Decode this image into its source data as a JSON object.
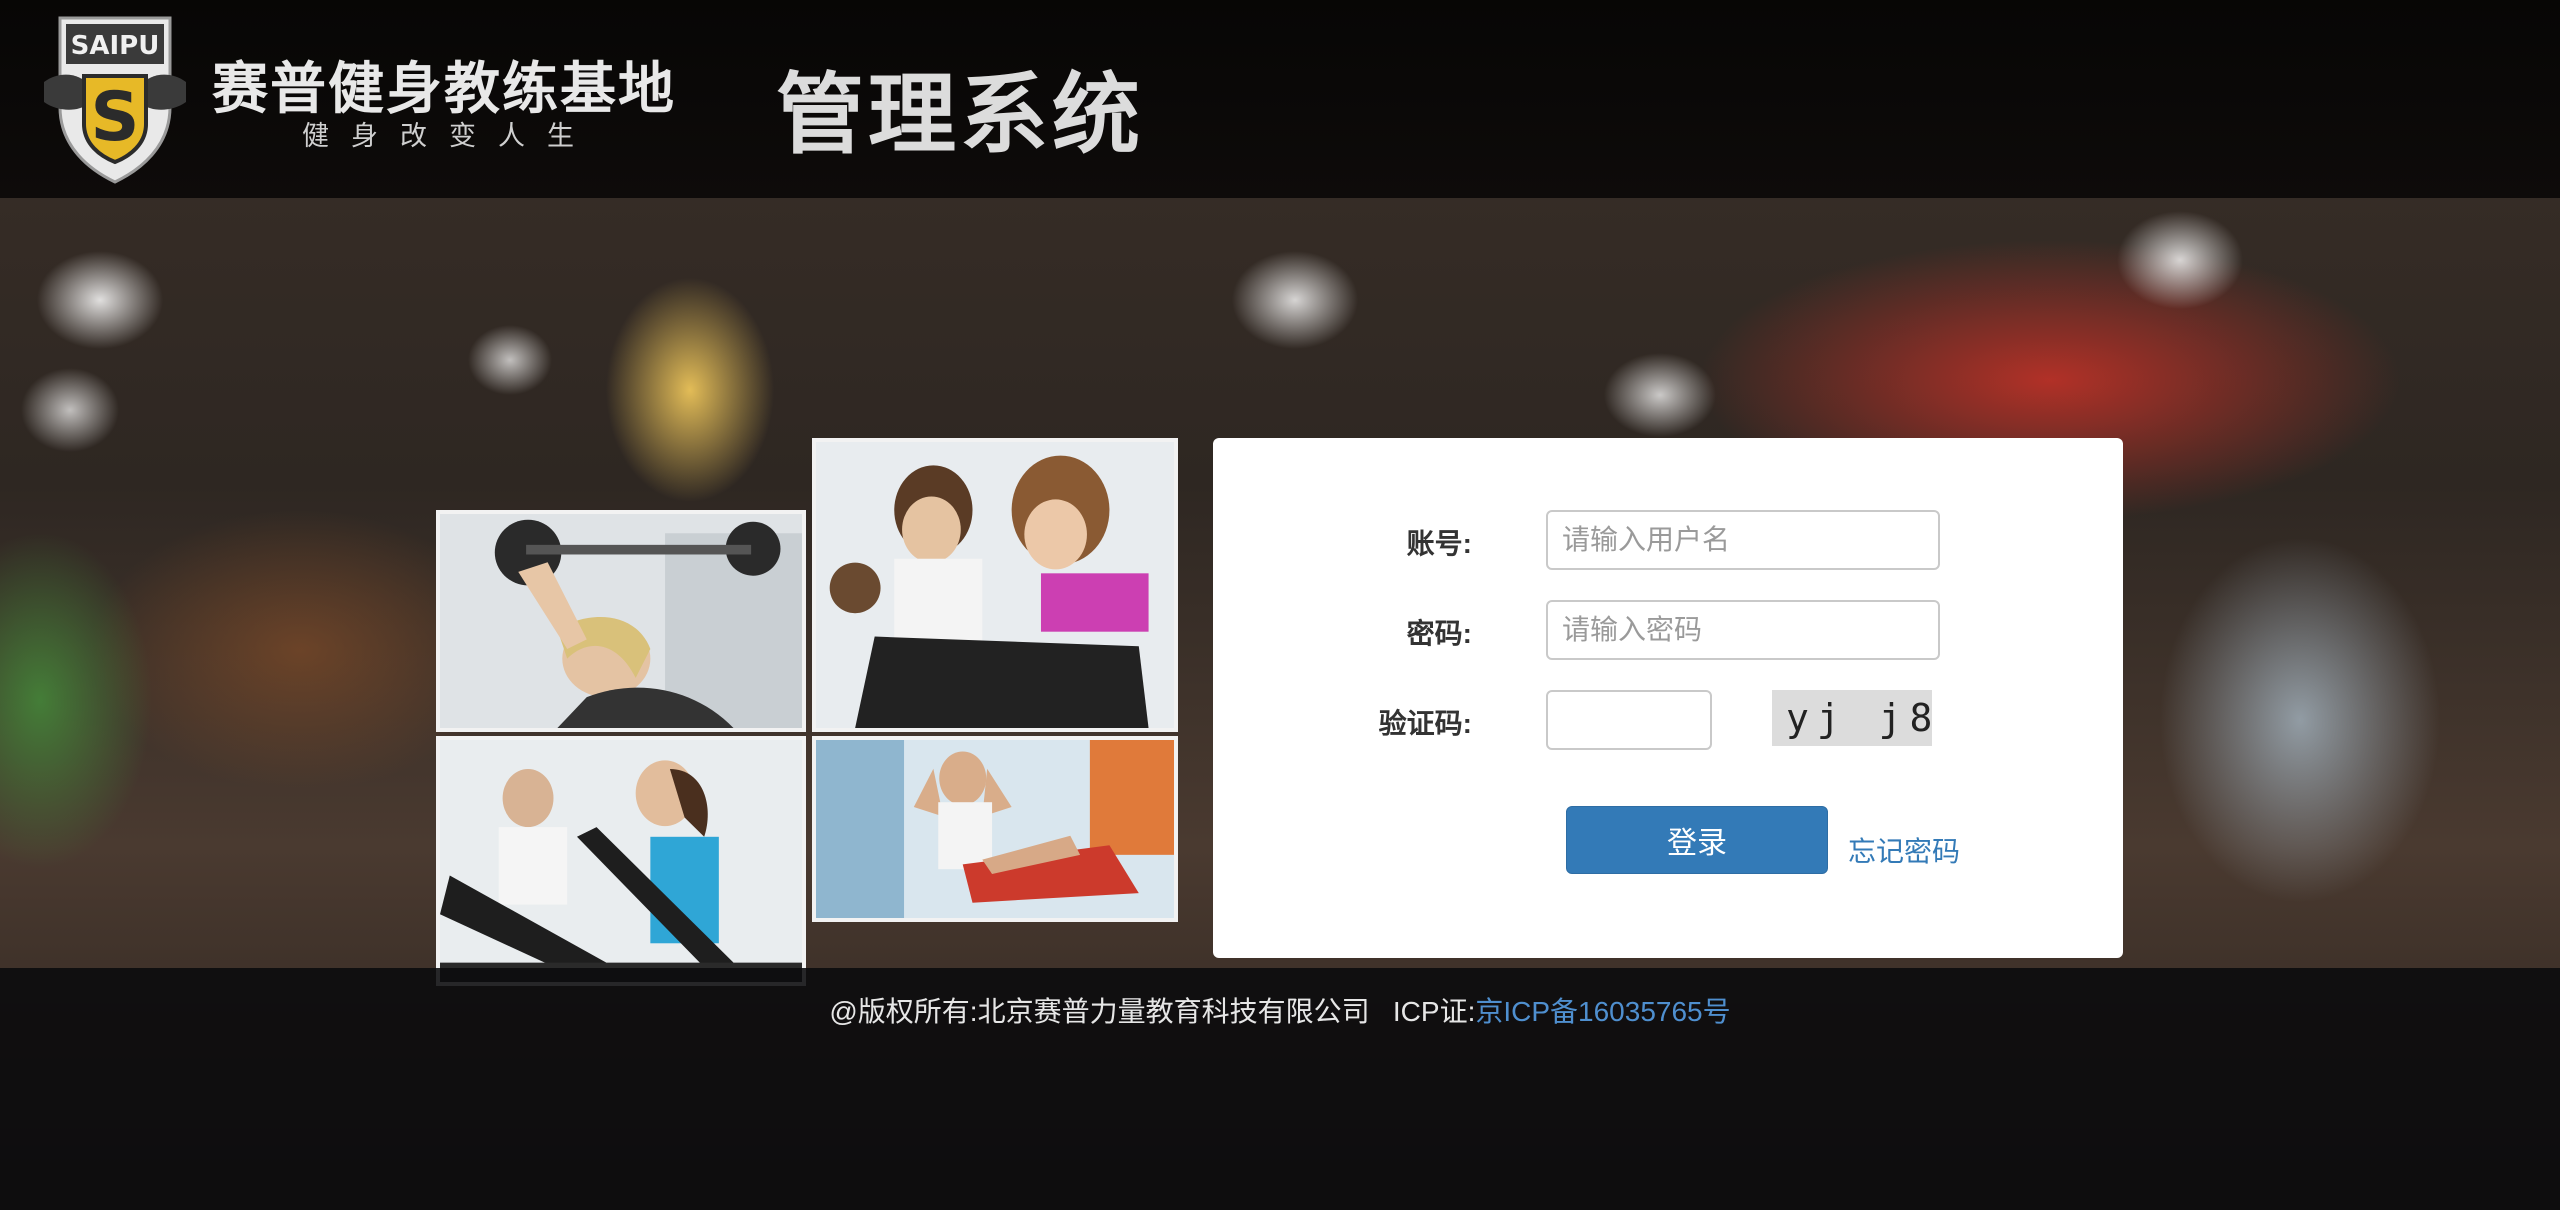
{
  "header": {
    "logo_text": "SAIPU",
    "logo_letter": "S",
    "brand_name": "赛普健身教练基地",
    "brand_slogan": "健身改变人生",
    "system_title": "管理系统"
  },
  "login": {
    "account_label": "账号:",
    "account_placeholder": "请输入用户名",
    "password_label": "密码:",
    "password_placeholder": "请输入密码",
    "captcha_label": "验证码:",
    "captcha_value": "",
    "captcha_text": "yj j8",
    "login_button": "登录",
    "forgot_link": "忘记密码"
  },
  "footer": {
    "copyright": "@版权所有:北京赛普力量教育科技有限公司   ICP证:",
    "icp_link": "京ICP备16035765号"
  },
  "colors": {
    "accent": "#337ab7",
    "panel": "#ffffff",
    "header_bg": "#0b0908"
  }
}
